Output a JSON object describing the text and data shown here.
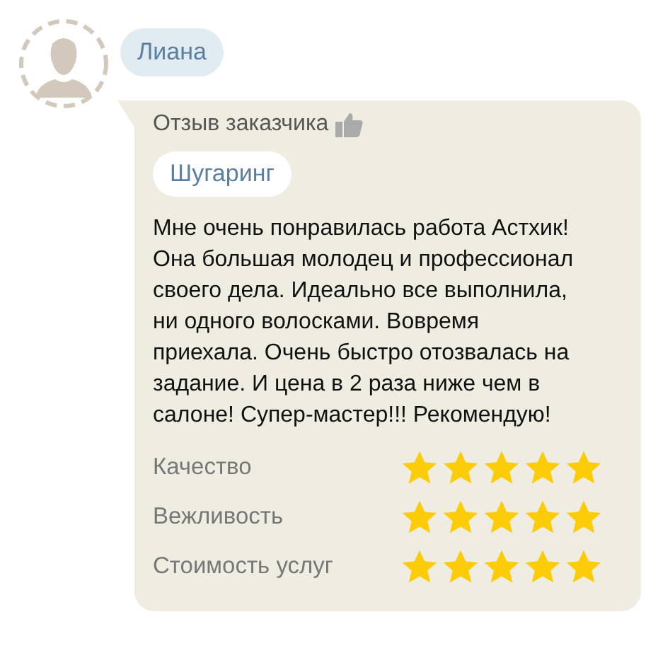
{
  "author": {
    "name": "Лиана"
  },
  "review": {
    "heading": "Отзыв заказчика",
    "service": "Шугаринг",
    "text": "Мне очень понравилась работа Астхик! Она большая молодец и профессионал своего дела. Идеально все выполнила, ни одного волосками. Вовремя приехала. Очень быстро отозвалась на задание. И цена в 2 раза ниже чем в салоне! Супер-мастер!!! Рекомендую!",
    "ratings": [
      {
        "label": "Качество",
        "stars": 5
      },
      {
        "label": "Вежливость",
        "stars": 5
      },
      {
        "label": "Стоимость услуг",
        "stars": 5
      }
    ]
  }
}
